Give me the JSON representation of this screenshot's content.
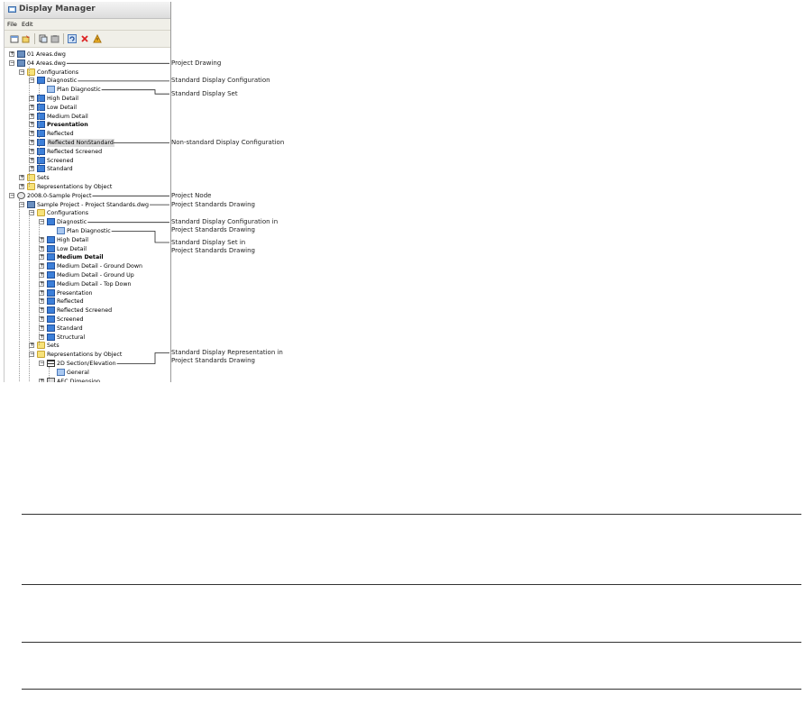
{
  "window": {
    "title": "Display Manager",
    "menu": [
      "File",
      "Edit"
    ],
    "toolbar_icons": [
      "new-icon",
      "open-icon",
      "copy-icon",
      "paste-icon",
      "refresh-icon",
      "delete-icon",
      "purge-icon"
    ]
  },
  "tree": [
    {
      "label": "01 Areas.dwg",
      "depth": 0,
      "exp": "+",
      "icon": "dwg"
    },
    {
      "label": "04 Areas.dwg",
      "depth": 0,
      "exp": "-",
      "icon": "dwg"
    },
    {
      "label": "Configurations",
      "depth": 1,
      "exp": "-",
      "icon": "folder"
    },
    {
      "label": "Diagnostic",
      "depth": 2,
      "exp": "-",
      "icon": "disp"
    },
    {
      "label": "Plan Diagnostic",
      "depth": 3,
      "exp": "",
      "icon": "set"
    },
    {
      "label": "High Detail",
      "depth": 2,
      "exp": "+",
      "icon": "disp"
    },
    {
      "label": "Low Detail",
      "depth": 2,
      "exp": "+",
      "icon": "disp"
    },
    {
      "label": "Medium Detail",
      "depth": 2,
      "exp": "+",
      "icon": "disp"
    },
    {
      "label": "Presentation",
      "depth": 2,
      "exp": "+",
      "icon": "disp",
      "bold": true
    },
    {
      "label": "Reflected",
      "depth": 2,
      "exp": "+",
      "icon": "disp"
    },
    {
      "label": "Reflected NonStandard",
      "depth": 2,
      "exp": "+",
      "icon": "disp",
      "selected": true
    },
    {
      "label": "Reflected Screened",
      "depth": 2,
      "exp": "+",
      "icon": "disp"
    },
    {
      "label": "Screened",
      "depth": 2,
      "exp": "+",
      "icon": "disp"
    },
    {
      "label": "Standard",
      "depth": 2,
      "exp": "+",
      "icon": "disp"
    },
    {
      "label": "Sets",
      "depth": 1,
      "exp": "+",
      "icon": "folder"
    },
    {
      "label": "Representations by Object",
      "depth": 1,
      "exp": "+",
      "icon": "folder"
    },
    {
      "label": "2008.0-Sample Project",
      "depth": 0,
      "exp": "-",
      "icon": "proj"
    },
    {
      "label": "Sample Project - Project Standards.dwg",
      "depth": 1,
      "exp": "-",
      "icon": "dwg"
    },
    {
      "label": "Configurations",
      "depth": 2,
      "exp": "-",
      "icon": "folder"
    },
    {
      "label": "Diagnostic",
      "depth": 3,
      "exp": "-",
      "icon": "disp"
    },
    {
      "label": "Plan Diagnostic",
      "depth": 4,
      "exp": "",
      "icon": "set"
    },
    {
      "label": "High Detail",
      "depth": 3,
      "exp": "+",
      "icon": "disp"
    },
    {
      "label": "Low Detail",
      "depth": 3,
      "exp": "+",
      "icon": "disp"
    },
    {
      "label": "Medium Detail",
      "depth": 3,
      "exp": "+",
      "icon": "disp",
      "bold": true
    },
    {
      "label": "Medium Detail - Ground Down",
      "depth": 3,
      "exp": "+",
      "icon": "disp"
    },
    {
      "label": "Medium Detail - Ground Up",
      "depth": 3,
      "exp": "+",
      "icon": "disp"
    },
    {
      "label": "Medium Detail - Top Down",
      "depth": 3,
      "exp": "+",
      "icon": "disp"
    },
    {
      "label": "Presentation",
      "depth": 3,
      "exp": "+",
      "icon": "disp"
    },
    {
      "label": "Reflected",
      "depth": 3,
      "exp": "+",
      "icon": "disp"
    },
    {
      "label": "Reflected Screened",
      "depth": 3,
      "exp": "+",
      "icon": "disp"
    },
    {
      "label": "Screened",
      "depth": 3,
      "exp": "+",
      "icon": "disp"
    },
    {
      "label": "Standard",
      "depth": 3,
      "exp": "+",
      "icon": "disp"
    },
    {
      "label": "Structural",
      "depth": 3,
      "exp": "+",
      "icon": "disp"
    },
    {
      "label": "Sets",
      "depth": 2,
      "exp": "+",
      "icon": "folder"
    },
    {
      "label": "Representations by Object",
      "depth": 2,
      "exp": "-",
      "icon": "folder"
    },
    {
      "label": "2D Section/Elevation",
      "depth": 3,
      "exp": "-",
      "icon": "grid"
    },
    {
      "label": "General",
      "depth": 4,
      "exp": "",
      "icon": "set"
    },
    {
      "label": "AEC Dimension",
      "depth": 3,
      "exp": "+",
      "icon": "dim"
    }
  ],
  "callouts": [
    {
      "text": "Project Drawing",
      "row": 1
    },
    {
      "text": "Standard Display Configuration",
      "row": 3
    },
    {
      "text": "Standard Display Set",
      "row": 4
    },
    {
      "text": "Non-standard Display Configuration",
      "row": 10
    },
    {
      "text": "Project Node",
      "row": 16
    },
    {
      "text": "Project Standards Drawing",
      "row": 17
    },
    {
      "text": "Standard Display Configuration in\nProject Standards Drawing",
      "row": 19
    },
    {
      "text": "Standard Display Set in\nProject Standards Drawing",
      "row": 20
    },
    {
      "text": "Standard Display Representation in\nProject Standards Drawing",
      "row": 35
    }
  ]
}
